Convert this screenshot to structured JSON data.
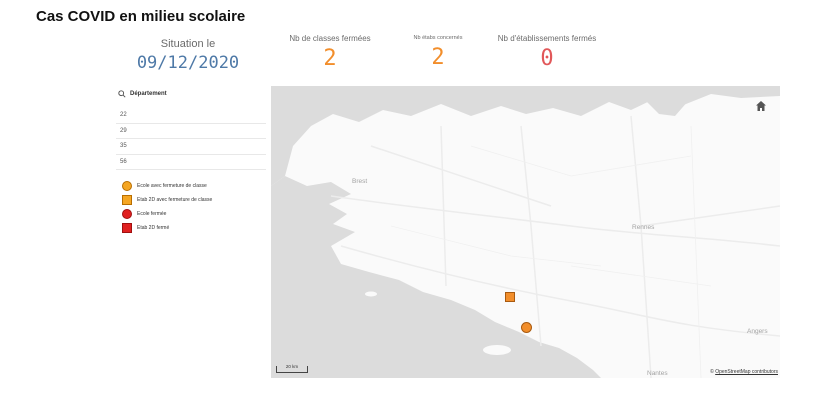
{
  "page": {
    "title": "Cas COVID en milieu scolaire"
  },
  "kpis": {
    "situation": {
      "label": "Situation le",
      "value": "09/12/2020"
    },
    "classes_fermees": {
      "label": "Nb de classes fermées",
      "value": "2",
      "color": "#f28e2b"
    },
    "etabs_concernes": {
      "label": "Nb étabs concernés",
      "value": "2",
      "color": "#f28e2b"
    },
    "etabs_fermes": {
      "label": "Nb d'établissements fermés",
      "value": "0",
      "color": "#e15759"
    }
  },
  "filter": {
    "title": "Département",
    "icon": "search-icon",
    "items": [
      "22",
      "29",
      "35",
      "56"
    ]
  },
  "legend": {
    "items": [
      {
        "label": "Ecole avec fermeture de classe",
        "symbol": "circle",
        "color": "#f5a623"
      },
      {
        "label": "Etab 2D avec fermeture de classe",
        "symbol": "square",
        "color": "#f5a623"
      },
      {
        "label": "Ecole fermée",
        "symbol": "circle",
        "color": "#e02020"
      },
      {
        "label": "Etab 2D fermé",
        "symbol": "square",
        "color": "#e02020"
      }
    ]
  },
  "map": {
    "cities": {
      "brest": "Brest",
      "rennes": "Rennes",
      "angers": "Angers",
      "nantes": "Nantes"
    },
    "scale_label": "20 km",
    "attribution": {
      "prefix": "© ",
      "link": "OpenStreetMap contributors"
    },
    "home_icon": "home-icon",
    "colors": {
      "land": "#fafafa",
      "sea": "#dcdcdc",
      "roads": "#ececec"
    }
  }
}
